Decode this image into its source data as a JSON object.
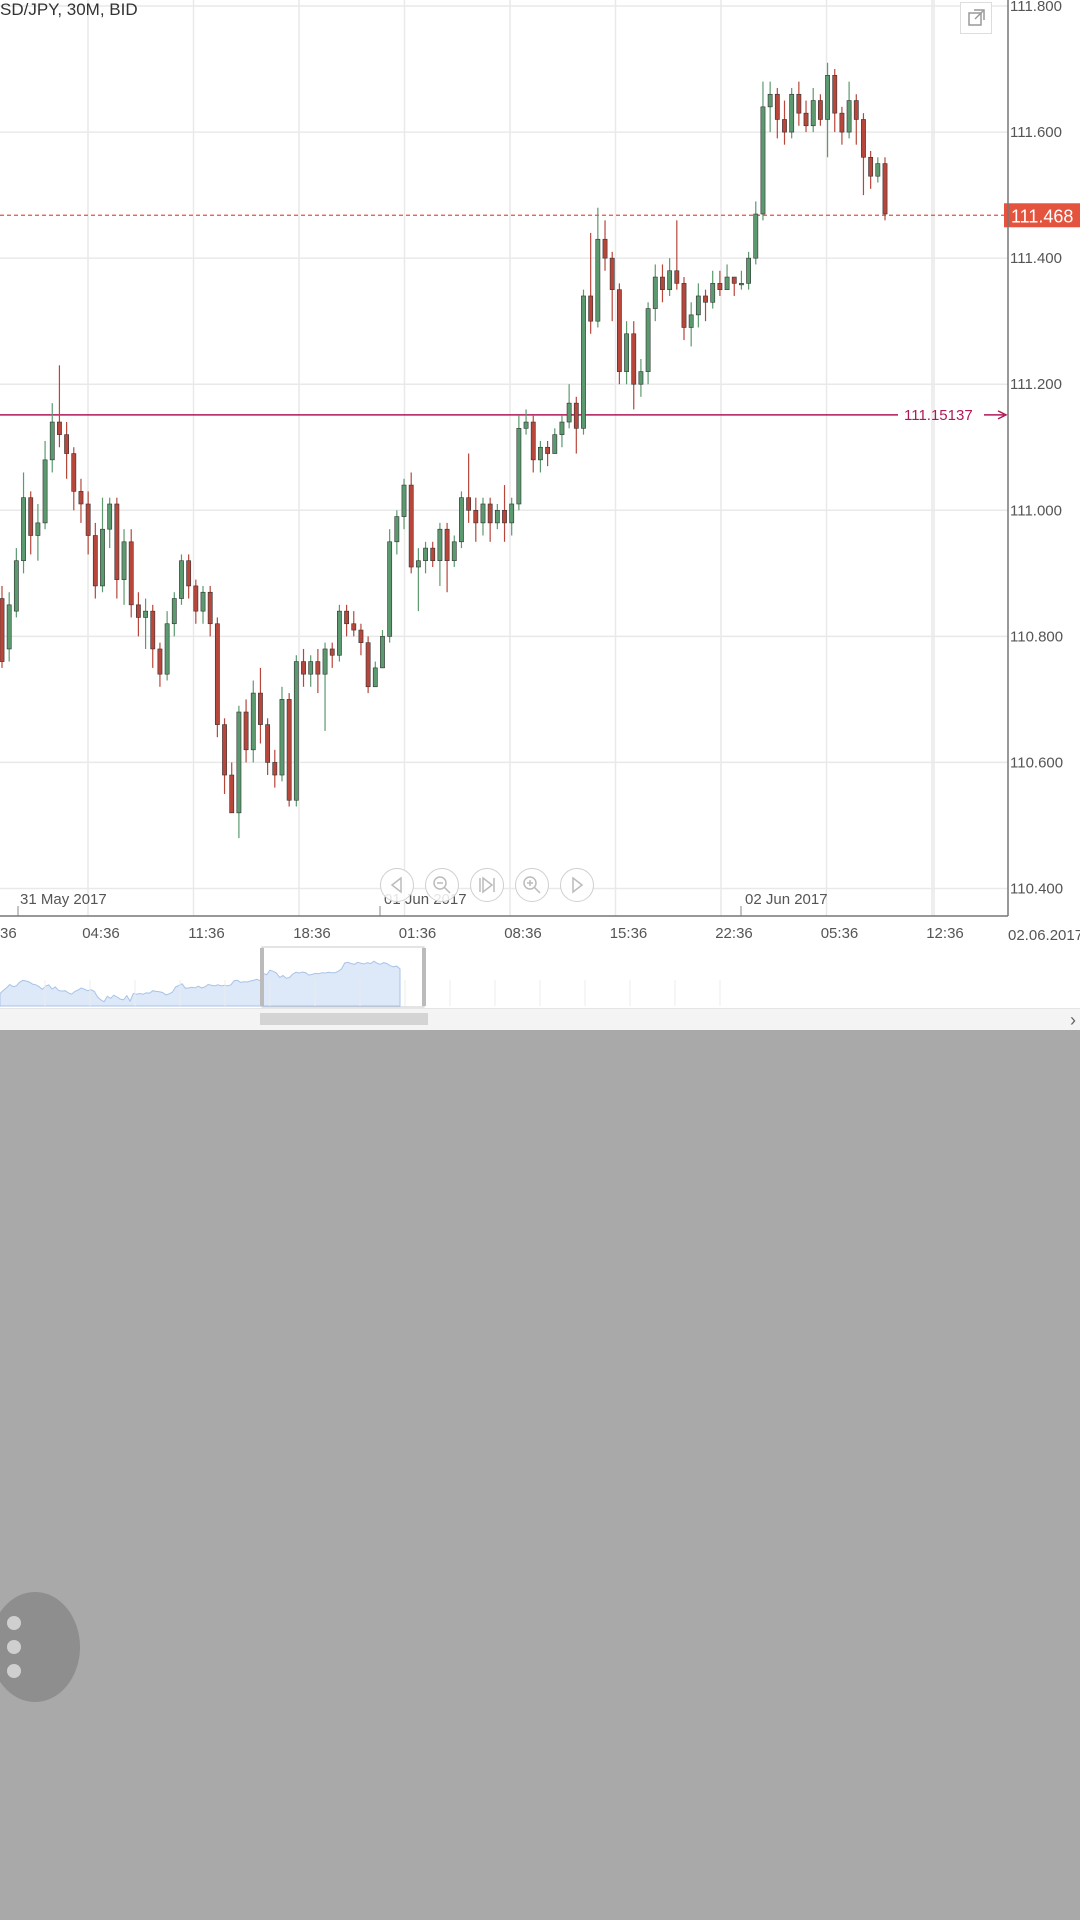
{
  "title": "SD/JPY, 30M, BID",
  "chart_data": {
    "type": "candlestick",
    "instrument": "USD/JPY",
    "timeframe": "30M",
    "price_type": "BID",
    "y_ticks": [
      "111.800",
      "111.600",
      "111.400",
      "111.200",
      "111.000",
      "110.800",
      "110.600",
      "110.400"
    ],
    "ylim": [
      110.38,
      111.8
    ],
    "x_ticks": [
      "36",
      "04:36",
      "11:36",
      "18:36",
      "01:36",
      "08:36",
      "15:36",
      "22:36",
      "05:36",
      "12:36"
    ],
    "date_labels": [
      "31 May 2017",
      "01 Jun 2017",
      "02 Jun 2017"
    ],
    "end_date_label": "02.06.2017",
    "current_price": "111.468",
    "current_price_value": 111.468,
    "horizontal_line": {
      "label": "111.15137",
      "value": 111.15137
    },
    "candles": [
      [
        110.86,
        110.76,
        110.88,
        110.75
      ],
      [
        110.78,
        110.85,
        110.87,
        110.76
      ],
      [
        110.84,
        110.92,
        110.94,
        110.83
      ],
      [
        110.92,
        111.02,
        111.06,
        110.9
      ],
      [
        111.02,
        110.96,
        111.03,
        110.93
      ],
      [
        110.96,
        110.98,
        111.01,
        110.92
      ],
      [
        110.98,
        111.08,
        111.11,
        110.97
      ],
      [
        111.08,
        111.14,
        111.17,
        111.06
      ],
      [
        111.14,
        111.12,
        111.23,
        111.1
      ],
      [
        111.12,
        111.09,
        111.14,
        111.05
      ],
      [
        111.09,
        111.03,
        111.1,
        111.0
      ],
      [
        111.03,
        111.01,
        111.05,
        110.98
      ],
      [
        111.01,
        110.96,
        111.03,
        110.93
      ],
      [
        110.96,
        110.88,
        110.98,
        110.86
      ],
      [
        110.88,
        110.97,
        111.02,
        110.87
      ],
      [
        110.97,
        111.01,
        111.02,
        110.94
      ],
      [
        111.01,
        110.89,
        111.02,
        110.86
      ],
      [
        110.89,
        110.95,
        110.97,
        110.85
      ],
      [
        110.95,
        110.85,
        110.97,
        110.83
      ],
      [
        110.85,
        110.83,
        110.87,
        110.8
      ],
      [
        110.83,
        110.84,
        110.86,
        110.78
      ],
      [
        110.84,
        110.78,
        110.85,
        110.75
      ],
      [
        110.78,
        110.74,
        110.79,
        110.72
      ],
      [
        110.74,
        110.82,
        110.84,
        110.73
      ],
      [
        110.82,
        110.86,
        110.87,
        110.8
      ],
      [
        110.86,
        110.92,
        110.93,
        110.85
      ],
      [
        110.92,
        110.88,
        110.93,
        110.86
      ],
      [
        110.88,
        110.84,
        110.89,
        110.82
      ],
      [
        110.84,
        110.87,
        110.88,
        110.82
      ],
      [
        110.87,
        110.82,
        110.88,
        110.8
      ],
      [
        110.82,
        110.66,
        110.83,
        110.64
      ],
      [
        110.66,
        110.58,
        110.67,
        110.55
      ],
      [
        110.58,
        110.52,
        110.6,
        110.52
      ],
      [
        110.52,
        110.68,
        110.69,
        110.48
      ],
      [
        110.68,
        110.62,
        110.7,
        110.6
      ],
      [
        110.62,
        110.71,
        110.73,
        110.6
      ],
      [
        110.71,
        110.66,
        110.75,
        110.63
      ],
      [
        110.66,
        110.6,
        110.67,
        110.58
      ],
      [
        110.6,
        110.58,
        110.62,
        110.56
      ],
      [
        110.58,
        110.7,
        110.72,
        110.57
      ],
      [
        110.7,
        110.54,
        110.71,
        110.53
      ],
      [
        110.54,
        110.76,
        110.77,
        110.53
      ],
      [
        110.76,
        110.74,
        110.78,
        110.72
      ],
      [
        110.74,
        110.76,
        110.77,
        110.72
      ],
      [
        110.76,
        110.74,
        110.78,
        110.71
      ],
      [
        110.74,
        110.78,
        110.79,
        110.65
      ],
      [
        110.78,
        110.77,
        110.79,
        110.75
      ],
      [
        110.77,
        110.84,
        110.85,
        110.76
      ],
      [
        110.84,
        110.82,
        110.85,
        110.8
      ],
      [
        110.82,
        110.81,
        110.84,
        110.8
      ],
      [
        110.81,
        110.79,
        110.82,
        110.77
      ],
      [
        110.79,
        110.72,
        110.8,
        110.71
      ],
      [
        110.72,
        110.75,
        110.76,
        110.72
      ],
      [
        110.75,
        110.8,
        110.81,
        110.75
      ],
      [
        110.8,
        110.95,
        110.97,
        110.79
      ],
      [
        110.95,
        110.99,
        111.0,
        110.93
      ],
      [
        110.99,
        111.04,
        111.05,
        110.97
      ],
      [
        111.04,
        110.91,
        111.06,
        110.9
      ],
      [
        110.91,
        110.92,
        110.94,
        110.84
      ],
      [
        110.92,
        110.94,
        110.95,
        110.9
      ],
      [
        110.94,
        110.92,
        110.95,
        110.91
      ],
      [
        110.92,
        110.97,
        110.98,
        110.88
      ],
      [
        110.97,
        110.92,
        110.98,
        110.87
      ],
      [
        110.92,
        110.95,
        110.96,
        110.91
      ],
      [
        110.95,
        111.02,
        111.03,
        110.94
      ],
      [
        111.02,
        111.0,
        111.09,
        110.98
      ],
      [
        111.0,
        110.98,
        111.02,
        110.95
      ],
      [
        110.98,
        111.01,
        111.02,
        110.96
      ],
      [
        111.01,
        110.98,
        111.02,
        110.95
      ],
      [
        110.98,
        111.0,
        111.01,
        110.97
      ],
      [
        111.0,
        110.98,
        111.04,
        110.95
      ],
      [
        110.98,
        111.01,
        111.02,
        110.96
      ],
      [
        111.01,
        111.13,
        111.15,
        111.0
      ],
      [
        111.13,
        111.14,
        111.16,
        111.12
      ],
      [
        111.14,
        111.08,
        111.15,
        111.06
      ],
      [
        111.08,
        111.1,
        111.11,
        111.06
      ],
      [
        111.1,
        111.09,
        111.11,
        111.07
      ],
      [
        111.09,
        111.12,
        111.13,
        111.09
      ],
      [
        111.12,
        111.14,
        111.15,
        111.1
      ],
      [
        111.14,
        111.17,
        111.2,
        111.13
      ],
      [
        111.17,
        111.13,
        111.18,
        111.09
      ],
      [
        111.13,
        111.34,
        111.35,
        111.12
      ],
      [
        111.34,
        111.3,
        111.44,
        111.28
      ],
      [
        111.3,
        111.43,
        111.48,
        111.29
      ],
      [
        111.43,
        111.4,
        111.46,
        111.38
      ],
      [
        111.4,
        111.35,
        111.41,
        111.3
      ],
      [
        111.35,
        111.22,
        111.36,
        111.2
      ],
      [
        111.22,
        111.28,
        111.3,
        111.2
      ],
      [
        111.28,
        111.2,
        111.3,
        111.16
      ],
      [
        111.2,
        111.22,
        111.24,
        111.18
      ],
      [
        111.22,
        111.32,
        111.33,
        111.2
      ],
      [
        111.32,
        111.37,
        111.39,
        111.3
      ],
      [
        111.37,
        111.35,
        111.39,
        111.33
      ],
      [
        111.35,
        111.38,
        111.4,
        111.34
      ],
      [
        111.38,
        111.36,
        111.46,
        111.35
      ],
      [
        111.36,
        111.29,
        111.37,
        111.27
      ],
      [
        111.29,
        111.31,
        111.33,
        111.26
      ],
      [
        111.31,
        111.34,
        111.36,
        111.29
      ],
      [
        111.34,
        111.33,
        111.35,
        111.3
      ],
      [
        111.33,
        111.36,
        111.38,
        111.32
      ],
      [
        111.36,
        111.35,
        111.38,
        111.34
      ],
      [
        111.35,
        111.37,
        111.39,
        111.35
      ],
      [
        111.37,
        111.36,
        111.37,
        111.34
      ],
      [
        111.36,
        111.36,
        111.38,
        111.35
      ],
      [
        111.36,
        111.4,
        111.41,
        111.35
      ],
      [
        111.4,
        111.47,
        111.49,
        111.39
      ],
      [
        111.47,
        111.64,
        111.68,
        111.46
      ],
      [
        111.64,
        111.66,
        111.68,
        111.6
      ],
      [
        111.66,
        111.62,
        111.67,
        111.59
      ],
      [
        111.62,
        111.6,
        111.65,
        111.58
      ],
      [
        111.6,
        111.66,
        111.67,
        111.59
      ],
      [
        111.66,
        111.63,
        111.68,
        111.61
      ],
      [
        111.63,
        111.61,
        111.65,
        111.6
      ],
      [
        111.61,
        111.65,
        111.67,
        111.6
      ],
      [
        111.65,
        111.62,
        111.66,
        111.61
      ],
      [
        111.62,
        111.69,
        111.71,
        111.56
      ],
      [
        111.69,
        111.63,
        111.7,
        111.6
      ],
      [
        111.63,
        111.6,
        111.64,
        111.58
      ],
      [
        111.6,
        111.65,
        111.68,
        111.59
      ],
      [
        111.65,
        111.62,
        111.66,
        111.58
      ],
      [
        111.62,
        111.56,
        111.63,
        111.5
      ],
      [
        111.56,
        111.53,
        111.57,
        111.51
      ],
      [
        111.53,
        111.55,
        111.56,
        111.52
      ],
      [
        111.55,
        111.47,
        111.56,
        111.46
      ]
    ]
  },
  "navigator": {
    "scroll_right_glyph": "›"
  },
  "controls": {
    "scroll_left_icon": "scroll-left-icon",
    "zoom_out_icon": "zoom-out-icon",
    "reset_icon": "reset-icon",
    "zoom_in_icon": "zoom-in-icon",
    "scroll_right_icon": "scroll-right-icon",
    "fullscreen_icon": "fullscreen-icon",
    "menu_icon": "more-vert-icon"
  },
  "colors": {
    "bull": "#5b9a6e",
    "bear": "#b8463a",
    "grid": "#e9e9e9",
    "price_badge": "#e4533d",
    "current_line": "#e4533d",
    "level_line": "#b01858",
    "navigator_fill": "#dde9f8",
    "navigator_stroke": "#a8c3e8",
    "background_below": "#a9a9a9"
  }
}
